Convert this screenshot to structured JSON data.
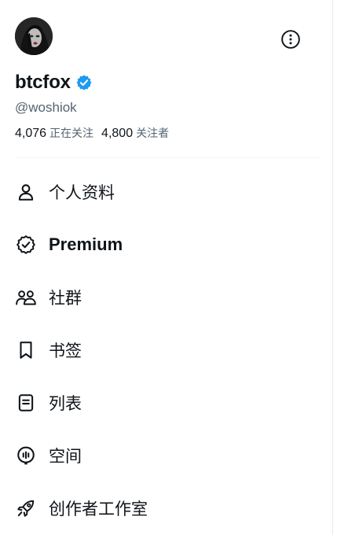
{
  "profile": {
    "display_name": "btcfox",
    "handle": "@woshiok",
    "verified": true,
    "avatar_icon": "profile-photo",
    "following_count": "4,076",
    "following_label": "正在关注",
    "followers_count": "4,800",
    "followers_label": "关注者"
  },
  "header": {
    "more_icon": "more-circle-icon"
  },
  "menu": {
    "items": [
      {
        "label": "个人资料",
        "icon": "person-icon"
      },
      {
        "label": "Premium",
        "icon": "premium-badge-icon"
      },
      {
        "label": "社群",
        "icon": "communities-icon"
      },
      {
        "label": "书签",
        "icon": "bookmark-icon"
      },
      {
        "label": "列表",
        "icon": "list-icon"
      },
      {
        "label": "空间",
        "icon": "spaces-icon"
      },
      {
        "label": "创作者工作室",
        "icon": "rocket-icon"
      }
    ]
  },
  "colors": {
    "text_primary": "#0f1419",
    "text_secondary": "#536471",
    "verified_blue": "#1d9bf0",
    "divider": "#eff3f4"
  }
}
